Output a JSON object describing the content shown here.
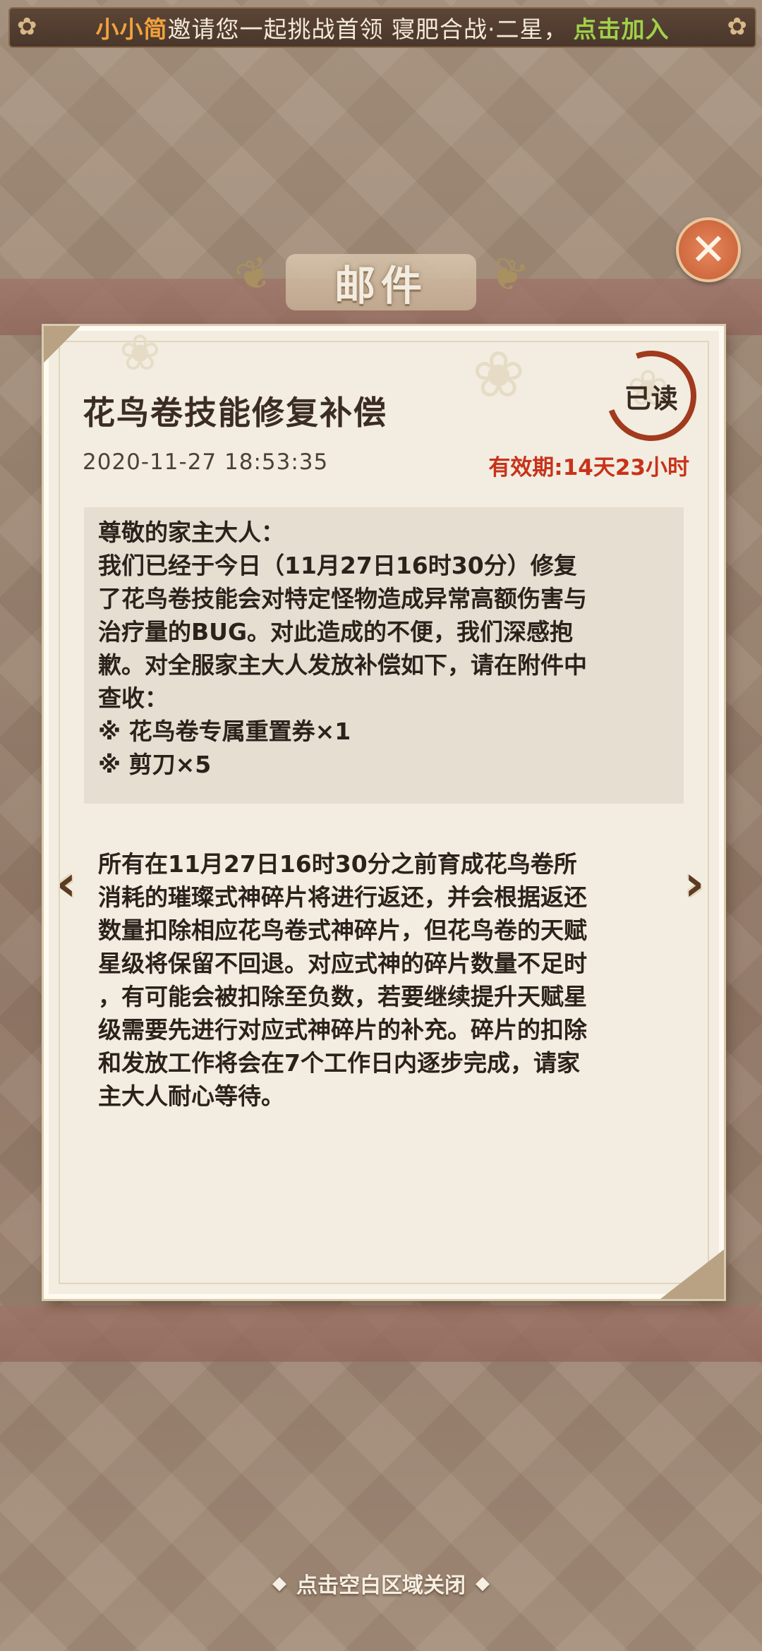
{
  "invite_banner": {
    "inviter": "小小简",
    "message": "邀请您一起挑战首领 寝肥合战·二星，",
    "join_label": "点击加入"
  },
  "panel_title": "邮件",
  "mail": {
    "title": "花鸟卷技能修复补偿",
    "read_stamp": "已读",
    "datetime": "2020-11-27 18:53:35",
    "expiry": "有效期:14天23小时",
    "paragraphs_box": [
      "尊敬的家主大人：",
      "我们已经于今日（11月27日16时30分）修复",
      "了花鸟卷技能会对特定怪物造成异常高额伤害与",
      "治疗量的BUG。对此造成的不便，我们深感抱",
      "歉。对全服家主大人发放补偿如下，请在附件中",
      "查收：",
      "※ 花鸟卷专属重置券×1",
      "※ 剪刀×5"
    ],
    "paragraphs_rest": [
      "所有在11月27日16时30分之前育成花鸟卷所",
      "消耗的璀璨式神碎片将进行返还，并会根据返还",
      "数量扣除相应花鸟卷式神碎片，但花鸟卷的天赋",
      "星级将保留不回退。对应式神的碎片数量不足时",
      "，有可能会被扣除至负数，若要继续提升天赋星",
      "级需要先进行对应式神碎片的补充。碎片的扣除",
      "和发放工作将会在7个工作日内逐步完成，请家",
      "主大人耐心等待。"
    ]
  },
  "icons": {
    "close": "close-icon",
    "prev": "chevron-left-icon",
    "next": "chevron-right-icon"
  },
  "close_hint": "点击空白区域关闭",
  "colors": {
    "expiry": "#c8321a",
    "inviter": "#f2a23d",
    "join": "#9fd14a",
    "stamp": "#a23a1e"
  }
}
